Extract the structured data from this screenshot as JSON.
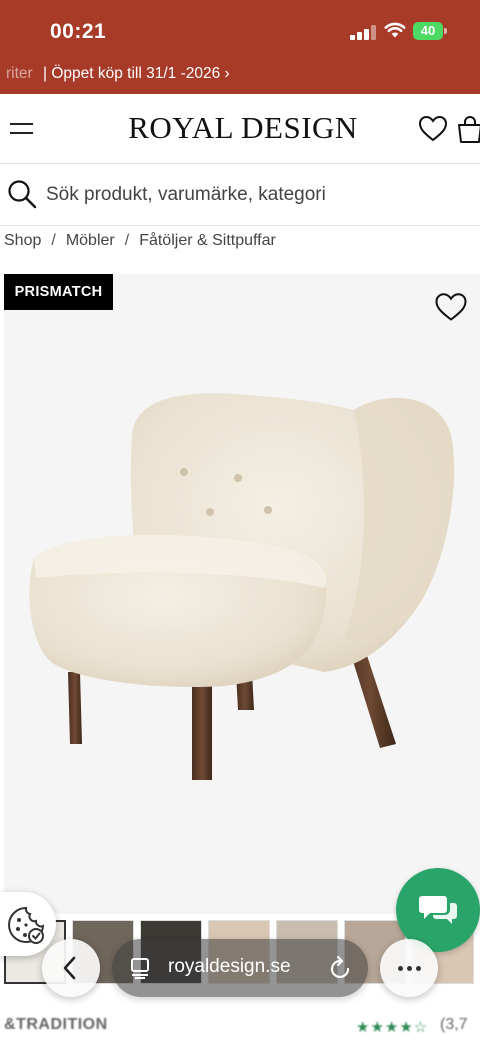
{
  "status_bar": {
    "time": "00:21",
    "battery": "40"
  },
  "promo": {
    "faded_text": "riter",
    "text": "| Öppet köp till 31/1 -2026 ›"
  },
  "header": {
    "logo": "ROYAL DESIGN",
    "menu_icon": "hamburger-icon",
    "wishlist_icon": "heart-icon",
    "cart_icon": "bag-icon"
  },
  "search": {
    "placeholder": "Sök produkt, varumärke, kategori",
    "icon": "search-icon"
  },
  "breadcrumb": [
    "Shop",
    "Möbler",
    "Fåtöljer & Sittpuffar"
  ],
  "product": {
    "badge": "PRISMATCH",
    "brand": "&TRADITION",
    "rating_stars": "★★★★☆",
    "rating_count": "(3,7"
  },
  "browser": {
    "url": "royaldesign.se"
  },
  "colors": {
    "promo_bg": "#a83a28",
    "chat_green": "#2aa56a",
    "badge_bg": "#000000"
  }
}
